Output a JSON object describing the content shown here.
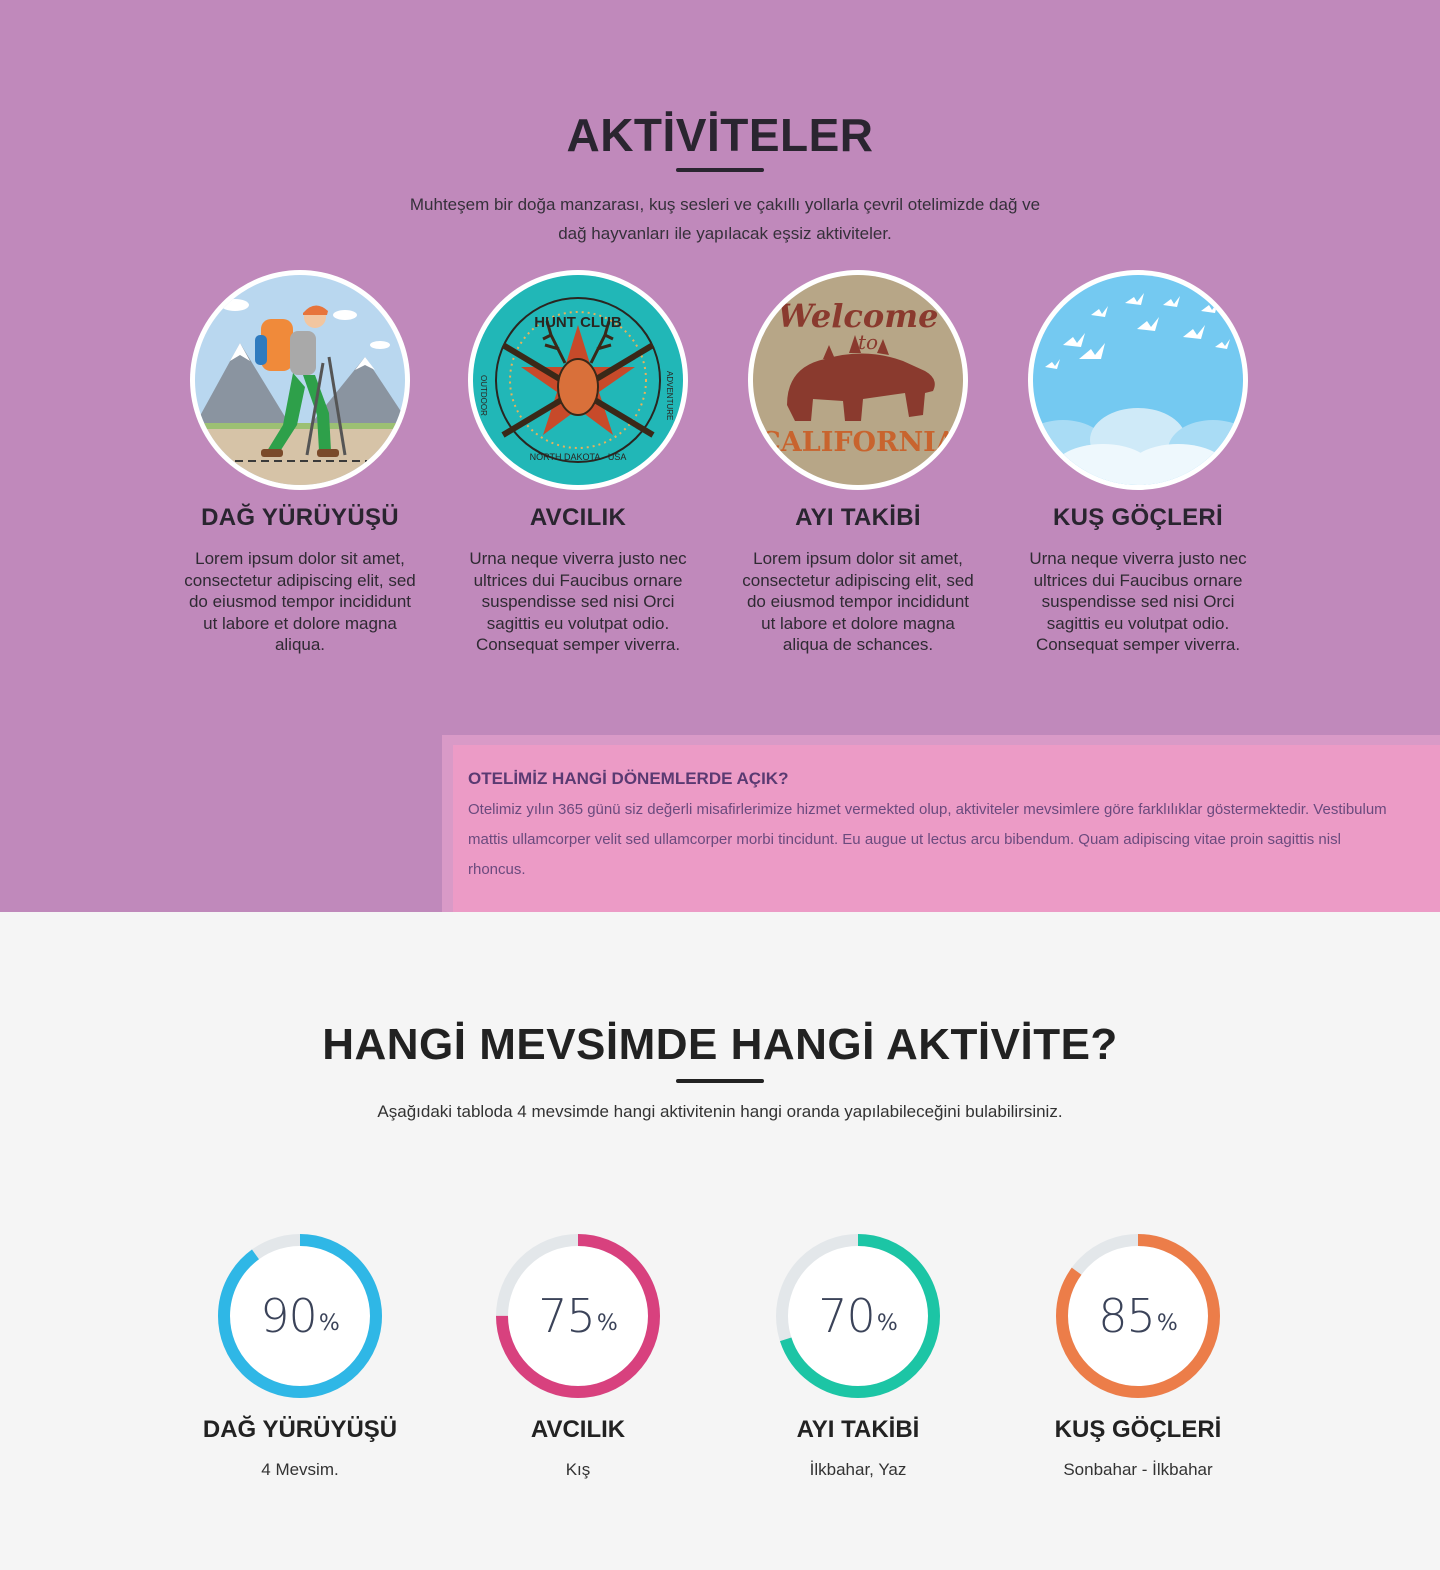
{
  "activities": {
    "title": "AKTİVİTELER",
    "intro": "Muhteşem bir doğa manzarası, kuş sesleri ve çakıllı yollarla çevril otelimizde dağ ve dağ hayvanları ile yapılacak eşsiz aktiviteler.",
    "cards": [
      {
        "title": "DAĞ YÜRÜYÜŞÜ",
        "text": "Lorem ipsum dolor sit amet, consectetur adipiscing elit, sed do eiusmod tempor incididunt ut labore et dolore magna aliqua.",
        "icon": "hiker-illustration"
      },
      {
        "title": "AVCILIK",
        "text": "Urna neque viverra justo nec ultrices dui Faucibus ornare suspendisse sed nisi Orci sagittis eu volutpat odio. Consequat semper viverra.",
        "icon": "hunt-club-badge",
        "badge_text": "HUNT CLUB",
        "badge_left": "OUTDOOR",
        "badge_right": "ADVENTURE",
        "badge_bottom": "NORTH DAKOTA · USA"
      },
      {
        "title": "AYI TAKİBİ",
        "text": "Lorem ipsum dolor sit amet, consectetur adipiscing elit, sed do eiusmod tempor incididunt ut labore et dolore magna aliqua de schances.",
        "icon": "bear-california-badge",
        "badge_top": "Welcome",
        "badge_mid": "to",
        "badge_bottom": "CALIFORNIA"
      },
      {
        "title": "KUŞ GÖÇLERİ",
        "text": "Urna neque viverra justo nec ultrices dui Faucibus ornare suspendisse sed nisi Orci sagittis eu volutpat odio. Consequat semper viverra.",
        "icon": "flying-birds-sky"
      }
    ],
    "info": {
      "title": "OTELİMİZ HANGİ DÖNEMLERDE AÇIK?",
      "text": "Otelimiz yılın 365 günü siz değerli misafirlerimize hizmet vermekted olup, aktiviteler mevsimlere göre farklılıklar göstermektedir. Vestibulum mattis ullamcorper velit sed ullamcorper morbi tincidunt. Eu augue ut lectus arcu bibendum. Quam adipiscing vitae proin sagittis nisl rhoncus."
    }
  },
  "seasons": {
    "title": "HANGİ MEVSİMDE HANGİ AKTİVİTE?",
    "intro": "Aşağıdaki tabloda 4 mevsimde hangi aktivitenin hangi oranda yapılabileceğini bulabilirsiniz.",
    "percent_sign": "%",
    "stats": [
      {
        "value": "90",
        "fraction": 0.9,
        "color": "#2fb7e6",
        "title": "DAĞ YÜRÜYÜŞÜ",
        "season": "4 Mevsim."
      },
      {
        "value": "75",
        "fraction": 0.75,
        "color": "#d8417e",
        "title": "AVCILIK",
        "season": "Kış"
      },
      {
        "value": "70",
        "fraction": 0.7,
        "color": "#1cc5a5",
        "title": "AYI TAKİBİ",
        "season": "İlkbahar, Yaz"
      },
      {
        "value": "85",
        "fraction": 0.85,
        "color": "#ec7d49",
        "title": "KUŞ GÖÇLERİ",
        "season": "Sonbahar - İlkbahar"
      }
    ]
  },
  "colors": {
    "activities_bg": "#c089bb",
    "info_bg": "#ec9bc6",
    "ring_track": "#e3e7ea"
  }
}
